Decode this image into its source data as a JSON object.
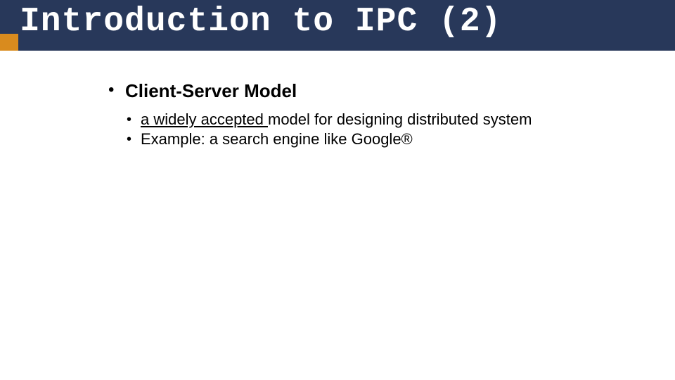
{
  "slide": {
    "title": "Introduction to IPC (2)",
    "heading": "Client-Server Model",
    "sub1_underlined": "a widely accepted ",
    "sub1_rest": "model for designing distributed system",
    "sub2": "Example: a search engine like Google®"
  }
}
